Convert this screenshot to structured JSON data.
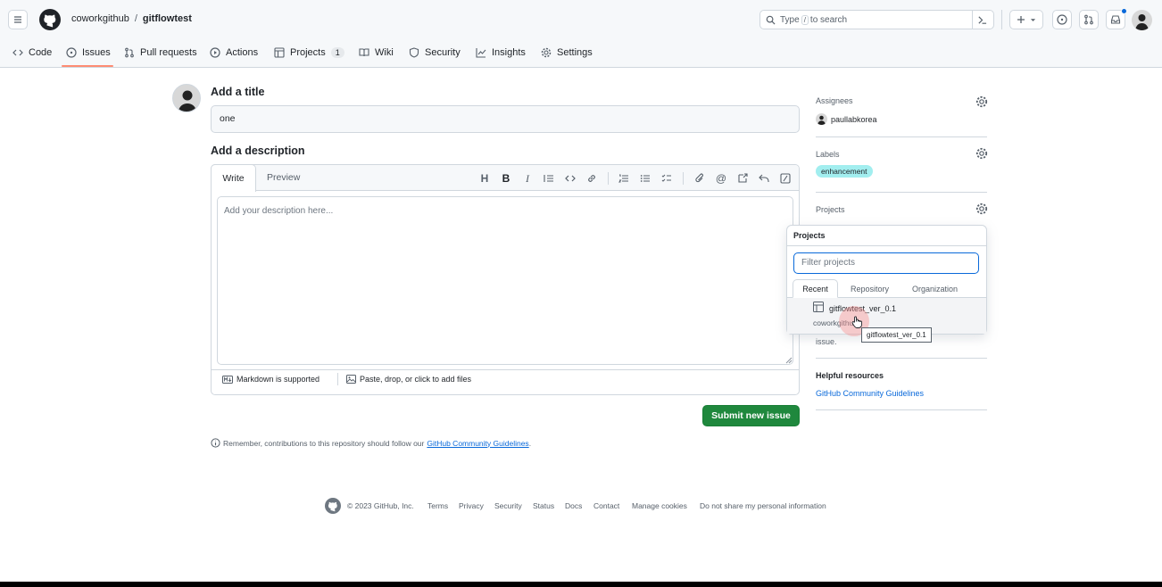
{
  "header": {
    "owner": "coworkgithub",
    "separator": "/",
    "repo": "gitflowtest",
    "search_prefix": "Type",
    "search_key": "/",
    "search_suffix": "to search"
  },
  "tabs": [
    {
      "label": "Code"
    },
    {
      "label": "Issues"
    },
    {
      "label": "Pull requests"
    },
    {
      "label": "Actions"
    },
    {
      "label": "Projects",
      "count": "1"
    },
    {
      "label": "Wiki"
    },
    {
      "label": "Security"
    },
    {
      "label": "Insights"
    },
    {
      "label": "Settings"
    }
  ],
  "form": {
    "title_heading": "Add a title",
    "title_value": "one",
    "description_heading": "Add a description",
    "write_tab": "Write",
    "preview_tab": "Preview",
    "description_placeholder": "Add your description here...",
    "markdown_note": "Markdown is supported",
    "attach_note": "Paste, drop, or click to add files",
    "submit_label": "Submit new issue",
    "reminder_text": "Remember, contributions to this repository should follow our",
    "reminder_link": "GitHub Community Guidelines",
    "reminder_end": "."
  },
  "sidebar": {
    "assignees_title": "Assignees",
    "assignee_name": "paullabkorea",
    "labels_title": "Labels",
    "label_name": "enhancement",
    "label_color": "#a2eeef",
    "projects_title": "Projects",
    "partial_text": "issue.",
    "helpful_title": "Helpful resources",
    "helpful_link": "GitHub Community Guidelines"
  },
  "projects_popup": {
    "title": "Projects",
    "filter_placeholder": "Filter projects",
    "tabs": [
      "Recent",
      "Repository",
      "Organization"
    ],
    "item_name": "gitflowtest_ver_0.1",
    "item_owner": "coworkgithub",
    "tooltip": "gitflowtest_ver_0.1"
  },
  "footer": {
    "copyright": "© 2023 GitHub, Inc.",
    "links": [
      "Terms",
      "Privacy",
      "Security",
      "Status",
      "Docs",
      "Contact",
      "Manage cookies",
      "Do not share my personal information"
    ]
  },
  "colors": {
    "accent": "#fd8c73",
    "link": "#0969da",
    "submit_bg": "#1f883d",
    "notification_dot": "#0969da"
  }
}
